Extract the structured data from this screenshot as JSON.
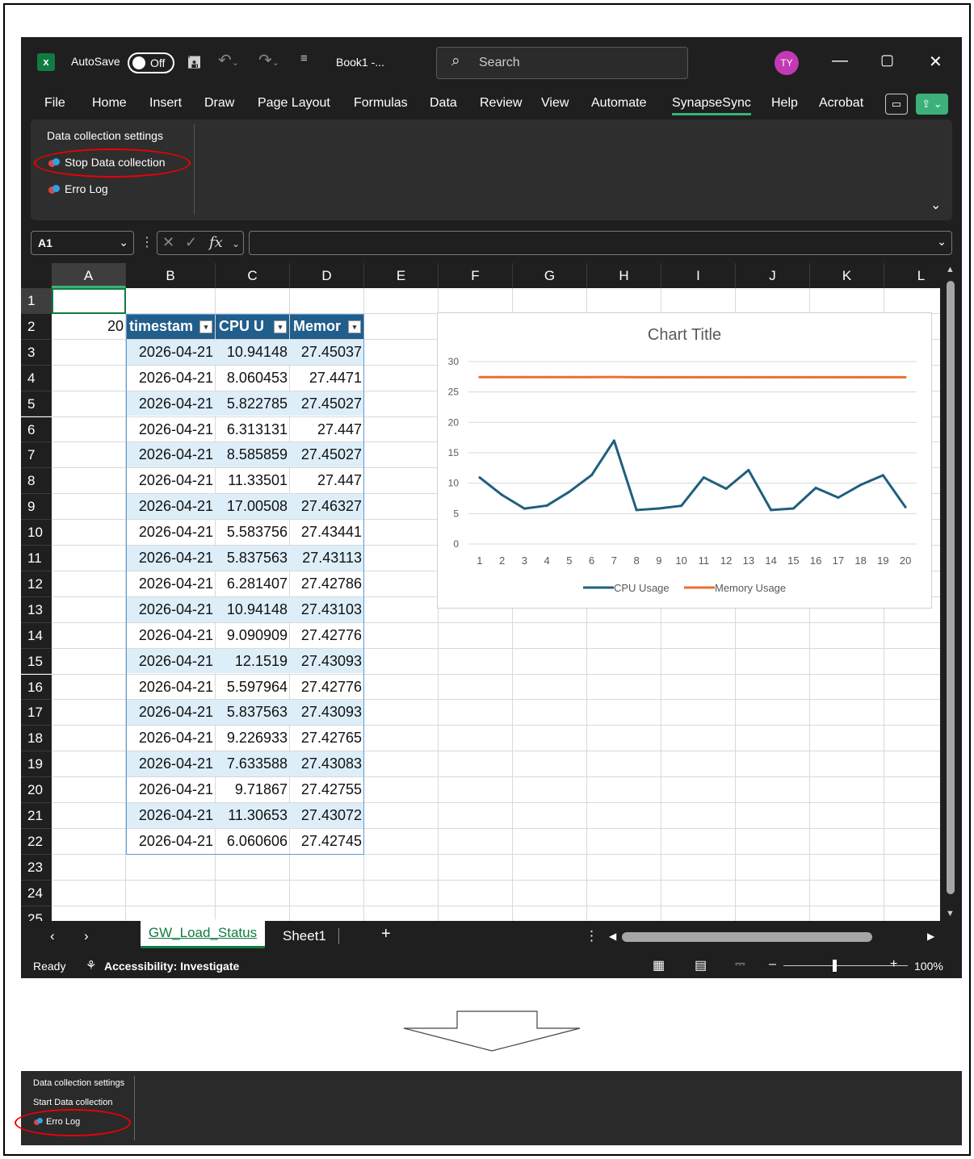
{
  "titlebar": {
    "autosave_label": "AutoSave",
    "autosave_state": "Off",
    "book_title": "Book1 -...",
    "search_placeholder": "Search",
    "avatar_initials": "TY"
  },
  "menu": [
    "File",
    "Home",
    "Insert",
    "Draw",
    "Page Layout",
    "Formulas",
    "Data",
    "Review",
    "View",
    "Automate",
    "SynapseSync",
    "Help",
    "Acrobat"
  ],
  "menu_active": "SynapseSync",
  "ribbon": {
    "group_title": "Data collection settings",
    "stop_button": "Stop Data collection",
    "log_button": "Erro Log"
  },
  "formula_bar": {
    "name_box": "A1",
    "fx_label": "fx",
    "formula": ""
  },
  "grid": {
    "columns": [
      "A",
      "B",
      "C",
      "D",
      "E",
      "F",
      "G",
      "H",
      "I",
      "J",
      "K",
      "L"
    ],
    "selected_column": "A",
    "rows": [
      "1",
      "2",
      "3",
      "4",
      "5",
      "6",
      "7",
      "8",
      "9",
      "10",
      "11",
      "12",
      "13",
      "14",
      "15",
      "16",
      "17",
      "18",
      "19",
      "20",
      "21",
      "22",
      "23",
      "24",
      "25"
    ],
    "a2_value": "20",
    "table_headers": [
      "timestam",
      "CPU U",
      "Memor"
    ],
    "table_rows": [
      [
        "2026-04-21",
        "10.94148",
        "27.45037"
      ],
      [
        "2026-04-21",
        "8.060453",
        "27.4471"
      ],
      [
        "2026-04-21",
        "5.822785",
        "27.45027"
      ],
      [
        "2026-04-21",
        "6.313131",
        "27.447"
      ],
      [
        "2026-04-21",
        "8.585859",
        "27.45027"
      ],
      [
        "2026-04-21",
        "11.33501",
        "27.447"
      ],
      [
        "2026-04-21",
        "17.00508",
        "27.46327"
      ],
      [
        "2026-04-21",
        "5.583756",
        "27.43441"
      ],
      [
        "2026-04-21",
        "5.837563",
        "27.43113"
      ],
      [
        "2026-04-21",
        "6.281407",
        "27.42786"
      ],
      [
        "2026-04-21",
        "10.94148",
        "27.43103"
      ],
      [
        "2026-04-21",
        "9.090909",
        "27.42776"
      ],
      [
        "2026-04-21",
        "12.1519",
        "27.43093"
      ],
      [
        "2026-04-21",
        "5.597964",
        "27.42776"
      ],
      [
        "2026-04-21",
        "5.837563",
        "27.43093"
      ],
      [
        "2026-04-21",
        "9.226933",
        "27.42765"
      ],
      [
        "2026-04-21",
        "7.633588",
        "27.43083"
      ],
      [
        "2026-04-21",
        "9.71867",
        "27.42755"
      ],
      [
        "2026-04-21",
        "11.30653",
        "27.43072"
      ],
      [
        "2026-04-21",
        "6.060606",
        "27.42745"
      ]
    ]
  },
  "chart_data": {
    "type": "line",
    "title": "Chart Title",
    "categories": [
      "1",
      "2",
      "3",
      "4",
      "5",
      "6",
      "7",
      "8",
      "9",
      "10",
      "11",
      "12",
      "13",
      "14",
      "15",
      "16",
      "17",
      "18",
      "19",
      "20"
    ],
    "series": [
      {
        "name": "CPU Usage",
        "color": "#1f5f7e",
        "values": [
          10.94148,
          8.060453,
          5.822785,
          6.313131,
          8.585859,
          11.33501,
          17.00508,
          5.583756,
          5.837563,
          6.281407,
          10.94148,
          9.090909,
          12.1519,
          5.597964,
          5.837563,
          9.226933,
          7.633588,
          9.71867,
          11.30653,
          6.060606
        ]
      },
      {
        "name": "Memory Usage",
        "color": "#e97132",
        "values": [
          27.45037,
          27.4471,
          27.45027,
          27.447,
          27.45027,
          27.447,
          27.46327,
          27.43441,
          27.43113,
          27.42786,
          27.43103,
          27.42776,
          27.43093,
          27.42776,
          27.43093,
          27.42765,
          27.43083,
          27.42755,
          27.43072,
          27.42745
        ]
      }
    ],
    "ylim": [
      0,
      30
    ],
    "yticks": [
      0,
      5,
      10,
      15,
      20,
      25,
      30
    ],
    "grid": true,
    "legend": "bottom"
  },
  "sheet_tabs": {
    "active": "GW_Load_Status",
    "other": "Sheet1",
    "add": "+"
  },
  "status": {
    "ready": "Ready",
    "accessibility": "Accessibility: Investigate",
    "zoom": "100%"
  },
  "ribbon_after": {
    "group_title": "Data collection settings",
    "start_button": "Start Data collection",
    "log_button": "Erro Log"
  }
}
